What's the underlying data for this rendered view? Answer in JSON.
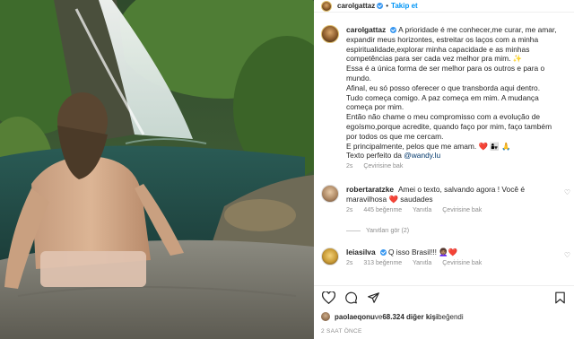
{
  "post": {
    "username": "carolgattaz",
    "follow_label": "Takip et",
    "photo_alt": "photo-waterfall"
  },
  "caption": {
    "username": "carolgattaz",
    "lines": [
      "A prioridade é me conhecer,me curar, me amar,",
      "expandir meus horizontes, estreitar os laços com a minha",
      "espiritualidade,explorar minha capacidade e as minhas",
      "competências para ser cada vez melhor pra mim. ✨",
      "Essa é a única forma de ser melhor para os outros e para o",
      "mundo.",
      "Afinal, eu só posso oferecer o que transborda aqui dentro.",
      "Tudo começa comigo. A paz começa em mim. A mudança",
      "começa por mim.",
      "Então não chame o meu compromisso com a evolução de",
      "egoísmo,porque acredite, quando faço por mim, faço também",
      "por todos os que me cercam.",
      "E principalmente, pelos que me amam. ❤️ 👩‍👧 🙏"
    ],
    "credit_prefix": "Texto perfeito da ",
    "credit_mention": "@wandy.lu",
    "time": "2s",
    "translate": "Çevirisine bak"
  },
  "comments": [
    {
      "username": "robertaratzke",
      "text_line1": "Amei o texto, salvando agora ! Você é",
      "text_line2": "maravilhosa ❤️ saudades",
      "time": "2s",
      "likes": "445 beğenme",
      "reply": "Yanıtla",
      "translate": "Çevirisine bak"
    },
    {
      "username": "leiasilva",
      "text_line1": "Q isso Brasil!!! 👩🏽‍🦱❤️",
      "time": "2s",
      "likes": "313 beğenme",
      "reply": "Yanıtla",
      "translate": "Çevirisine bak"
    }
  ],
  "replies_label": "Yanıtları gör (2)",
  "likes": {
    "user": "paolaeqonu",
    "mid": " ve ",
    "count": "68.324 diğer kişi",
    "suffix": " beğendi"
  },
  "timestamp": "2 SAAT ÖNCE",
  "icons": [
    "heart-icon",
    "comment-icon",
    "share-icon",
    "bookmark-icon",
    "verified-icon"
  ],
  "colors": {
    "link": "#0095f6",
    "mention": "#00376b",
    "muted": "#8e8e8e",
    "heart": "#ed4956"
  }
}
